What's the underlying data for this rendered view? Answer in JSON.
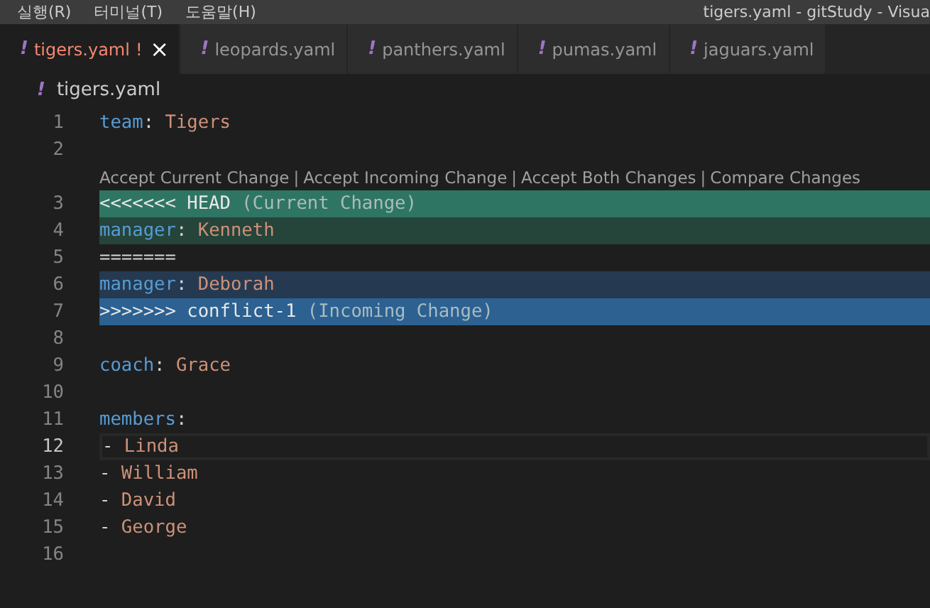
{
  "menu": [
    "실행(R)",
    "터미널(T)",
    "도움말(H)"
  ],
  "window_title": "tigers.yaml - gitStudy - Visua",
  "tabs": [
    {
      "icon": "!",
      "label": "tigers.yaml",
      "selected": true,
      "status": "!",
      "close": "×"
    },
    {
      "icon": "!",
      "label": "leopards.yaml",
      "selected": false
    },
    {
      "icon": "!",
      "label": "panthers.yaml",
      "selected": false
    },
    {
      "icon": "!",
      "label": "pumas.yaml",
      "selected": false
    },
    {
      "icon": "!",
      "label": "jaguars.yaml",
      "selected": false
    }
  ],
  "breadcrumb": {
    "icon": "!",
    "label": "tigers.yaml"
  },
  "lines": [
    {
      "number": "1",
      "kind": "normal",
      "active": false,
      "tokens": [
        {
          "kind": "key",
          "text": "team"
        },
        {
          "kind": "punct",
          "text": ": "
        },
        {
          "kind": "value",
          "text": "Tigers"
        }
      ]
    },
    {
      "number": "2",
      "kind": "normal",
      "active": false
    },
    {
      "number": "3",
      "kind": "current-marker",
      "active": false,
      "codelens": {
        "actions": [
          "Accept Current Change",
          "Accept Incoming Change",
          "Accept Both Changes",
          "Compare Changes"
        ],
        "separator": "|"
      },
      "tokens": [
        {
          "kind": "marker",
          "text": "<<<<<<< HEAD "
        },
        {
          "kind": "label",
          "text": "(Current Change)"
        }
      ]
    },
    {
      "number": "4",
      "kind": "current",
      "active": false,
      "tokens": [
        {
          "kind": "key",
          "text": "manager"
        },
        {
          "kind": "punct",
          "text": ": "
        },
        {
          "kind": "value",
          "text": "Kenneth"
        }
      ]
    },
    {
      "number": "5",
      "kind": "normal",
      "active": false,
      "tokens": [
        {
          "kind": "punct",
          "text": "======="
        }
      ]
    },
    {
      "number": "6",
      "kind": "incoming",
      "active": false,
      "tokens": [
        {
          "kind": "key",
          "text": "manager"
        },
        {
          "kind": "punct",
          "text": ": "
        },
        {
          "kind": "value",
          "text": "Deborah"
        }
      ]
    },
    {
      "number": "7",
      "kind": "incoming-marker",
      "active": false,
      "tokens": [
        {
          "kind": "marker",
          "text": ">>>>>>> conflict-1 "
        },
        {
          "kind": "label",
          "text": "(Incoming Change)"
        }
      ]
    },
    {
      "number": "8",
      "kind": "normal",
      "active": false
    },
    {
      "number": "9",
      "kind": "normal",
      "active": false,
      "tokens": [
        {
          "kind": "key",
          "text": "coach"
        },
        {
          "kind": "punct",
          "text": ": "
        },
        {
          "kind": "value",
          "text": "Grace"
        }
      ]
    },
    {
      "number": "10",
      "kind": "normal",
      "active": false
    },
    {
      "number": "11",
      "kind": "normal",
      "active": false,
      "tokens": [
        {
          "kind": "key",
          "text": "members"
        },
        {
          "kind": "punct",
          "text": ":"
        }
      ]
    },
    {
      "number": "12",
      "kind": "normal",
      "active": true,
      "tokens": [
        {
          "kind": "punct",
          "text": "- "
        },
        {
          "kind": "value",
          "text": "Linda"
        }
      ]
    },
    {
      "number": "13",
      "kind": "normal",
      "active": false,
      "tokens": [
        {
          "kind": "punct",
          "text": "- "
        },
        {
          "kind": "value",
          "text": "William"
        }
      ]
    },
    {
      "number": "14",
      "kind": "normal",
      "active": false,
      "tokens": [
        {
          "kind": "punct",
          "text": "- "
        },
        {
          "kind": "value",
          "text": "David"
        }
      ]
    },
    {
      "number": "15",
      "kind": "normal",
      "active": false,
      "tokens": [
        {
          "kind": "punct",
          "text": "- "
        },
        {
          "kind": "value",
          "text": "George"
        }
      ]
    },
    {
      "number": "16",
      "kind": "normal",
      "active": false
    }
  ]
}
